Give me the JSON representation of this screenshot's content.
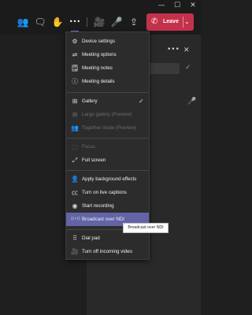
{
  "window": {
    "minimize_glyph": "—",
    "maximize_glyph": "☐",
    "close_glyph": "✕"
  },
  "toolbar": {
    "icons": [
      {
        "name": "participants-icon",
        "glyph": "👥"
      },
      {
        "name": "chat-icon",
        "glyph": "🗨"
      },
      {
        "name": "raise-hand-icon",
        "glyph": "✋"
      },
      {
        "name": "more-actions-icon",
        "glyph": "•••"
      },
      {
        "name": "camera-off-icon",
        "glyph": "🎥"
      },
      {
        "name": "microphone-icon",
        "glyph": "🎤"
      },
      {
        "name": "share-icon",
        "glyph": "⇪"
      }
    ],
    "leave_label": "Leave",
    "leave_icon_glyph": "✆",
    "leave_chevron_glyph": "⌄",
    "leave_color": "#c4314b"
  },
  "menu": {
    "items": [
      {
        "label": "Device settings",
        "icon": "gear-icon",
        "glyph": "⚙",
        "enabled": true
      },
      {
        "label": "Meeting options",
        "icon": "options-icon",
        "glyph": "⇌",
        "enabled": true
      },
      {
        "label": "Meeting notes",
        "icon": "notes-icon",
        "glyph": "🗒",
        "enabled": true
      },
      {
        "label": "Meeting details",
        "icon": "info-icon",
        "glyph": "ⓘ",
        "enabled": true
      },
      {
        "label": "Gallery",
        "icon": "gallery-icon",
        "glyph": "⊞",
        "enabled": true,
        "checked": true
      },
      {
        "label": "Large gallery (Preview)",
        "icon": "large-gallery-icon",
        "glyph": "⊞",
        "enabled": false
      },
      {
        "label": "Together mode (Preview)",
        "icon": "together-mode-icon",
        "glyph": "👥",
        "enabled": false
      },
      {
        "label": "Focus",
        "icon": "focus-icon",
        "glyph": "⬚",
        "enabled": false
      },
      {
        "label": "Full screen",
        "icon": "full-screen-icon",
        "glyph": "⤢",
        "enabled": true
      },
      {
        "label": "Apply background effects",
        "icon": "background-effects-icon",
        "glyph": "👤",
        "enabled": true
      },
      {
        "label": "Turn on live captions",
        "icon": "captions-icon",
        "glyph": "㏄",
        "enabled": true
      },
      {
        "label": "Start recording",
        "icon": "record-icon",
        "glyph": "◉",
        "enabled": true
      },
      {
        "label": "Broadcast over NDI",
        "icon": "broadcast-icon",
        "glyph": "((•))",
        "enabled": true,
        "highlighted": true
      },
      {
        "label": "Dial pad",
        "icon": "dial-pad-icon",
        "glyph": "⠿",
        "enabled": true
      },
      {
        "label": "Turn off incoming video",
        "icon": "video-off-icon",
        "glyph": "🎥",
        "enabled": true
      }
    ],
    "check_glyph": "✓",
    "highlight_color": "#6264a7"
  },
  "tooltip": {
    "text": "Broadcast over NDI"
  },
  "side_panel": {
    "close_glyph": "✕",
    "more_glyph": "•••",
    "check_glyph": "✓",
    "mic_glyph": "🎤"
  }
}
